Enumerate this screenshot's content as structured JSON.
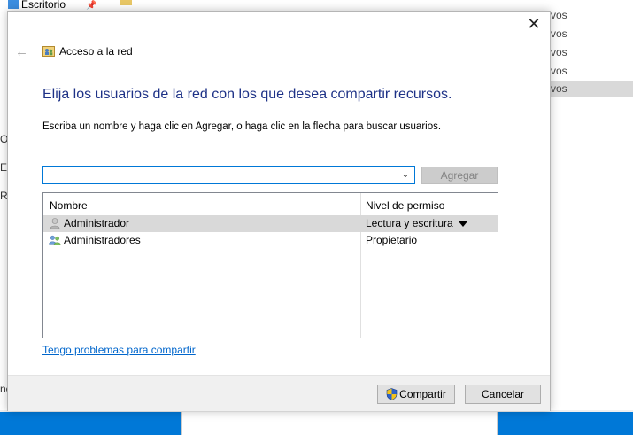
{
  "background": {
    "sidebar_item": "Escritorio",
    "list_fragments": [
      "vos",
      "vos",
      "vos",
      "vos",
      "vos"
    ],
    "edge_chars": [
      "O",
      "Es",
      "R",
      "ne"
    ]
  },
  "dialog": {
    "close_glyph": "✕",
    "back_glyph": "←",
    "title": "Acceso a la red",
    "heading": "Elija los usuarios de la red con los que desea compartir recursos.",
    "instruction": "Escriba un nombre y haga clic en Agregar, o haga clic en la flecha para buscar usuarios.",
    "combo_value": "",
    "add_button": "Agregar",
    "list": {
      "columns": [
        "Nombre",
        "Nivel de permiso"
      ],
      "rows": [
        {
          "name": "Administrador",
          "permission": "Lectura y escritura",
          "icon": "user-icon",
          "selected": true
        },
        {
          "name": "Administradores",
          "permission": "Propietario",
          "icon": "users-group-icon",
          "selected": false
        }
      ]
    },
    "help_link": "Tengo problemas para compartir",
    "share_button": "Compartir",
    "cancel_button": "Cancelar"
  },
  "colors": {
    "heading": "#1e3287",
    "link": "#0066cc",
    "focus_border": "#0078d7",
    "taskbar": "#0078d7"
  }
}
